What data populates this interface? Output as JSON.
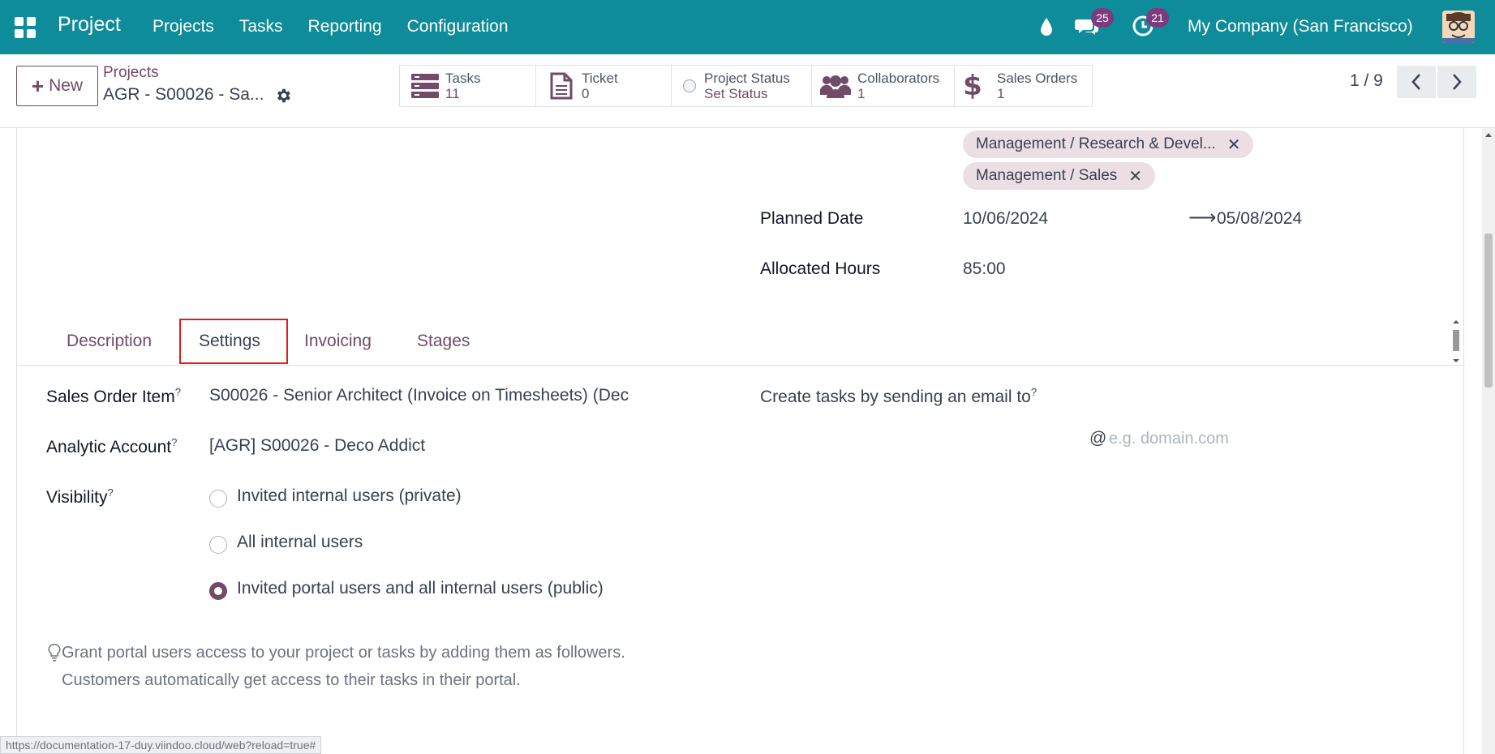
{
  "navbar": {
    "brand": "Project",
    "menu": [
      "Projects",
      "Tasks",
      "Reporting",
      "Configuration"
    ],
    "chat_count": "25",
    "activity_count": "21",
    "company": "My Company (San Francisco)"
  },
  "control": {
    "new_label": "New",
    "breadcrumb_parent": "Projects",
    "breadcrumb_current": "AGR - S00026 - Sa...",
    "smart_buttons": [
      {
        "label": "Tasks",
        "value": "11",
        "icon": "tasks-icon"
      },
      {
        "label": "Ticket",
        "value": "0",
        "icon": "document-icon"
      },
      {
        "label": "Project Status",
        "value": "Set Status",
        "icon": "status-circle-icon"
      },
      {
        "label": "Collaborators",
        "value": "1",
        "icon": "users-icon"
      },
      {
        "label": "Sales Orders",
        "value": "1",
        "icon": "dollar-icon"
      }
    ],
    "pager": "1 / 9"
  },
  "form": {
    "tags": [
      "Management / Research & Devel...",
      "Management / Sales"
    ],
    "planned_date_label": "Planned Date",
    "planned_date_start": "10/06/2024",
    "planned_date_end": "05/08/2024",
    "allocated_hours_label": "Allocated Hours",
    "allocated_hours": "85:00",
    "tabs": [
      "Description",
      "Settings",
      "Invoicing",
      "Stages"
    ],
    "sales_order_item_label": "Sales Order Item",
    "sales_order_item": "S00026 - Senior Architect (Invoice on Timesheets) (Dec",
    "analytic_account_label": "Analytic Account",
    "analytic_account": "[AGR] S00026 - Deco Addict",
    "visibility_label": "Visibility",
    "visibility_options": [
      "Invited internal users (private)",
      "All internal users",
      "Invited portal users and all internal users (public)"
    ],
    "email_label": "Create tasks by sending an email to",
    "email_at": "@",
    "email_placeholder": "e.g. domain.com",
    "hint_line1": "Grant portal users access to your project or tasks by adding them as followers.",
    "hint_line2": "Customers automatically get access to their tasks in their portal.",
    "help_mark": "?"
  },
  "status_url": "https://documentation-17-duy.viindoo.cloud/web?reload=true#",
  "colors": {
    "navbar": "#0e8c99",
    "accent": "#714b67",
    "highlight": "#e31d1d"
  }
}
